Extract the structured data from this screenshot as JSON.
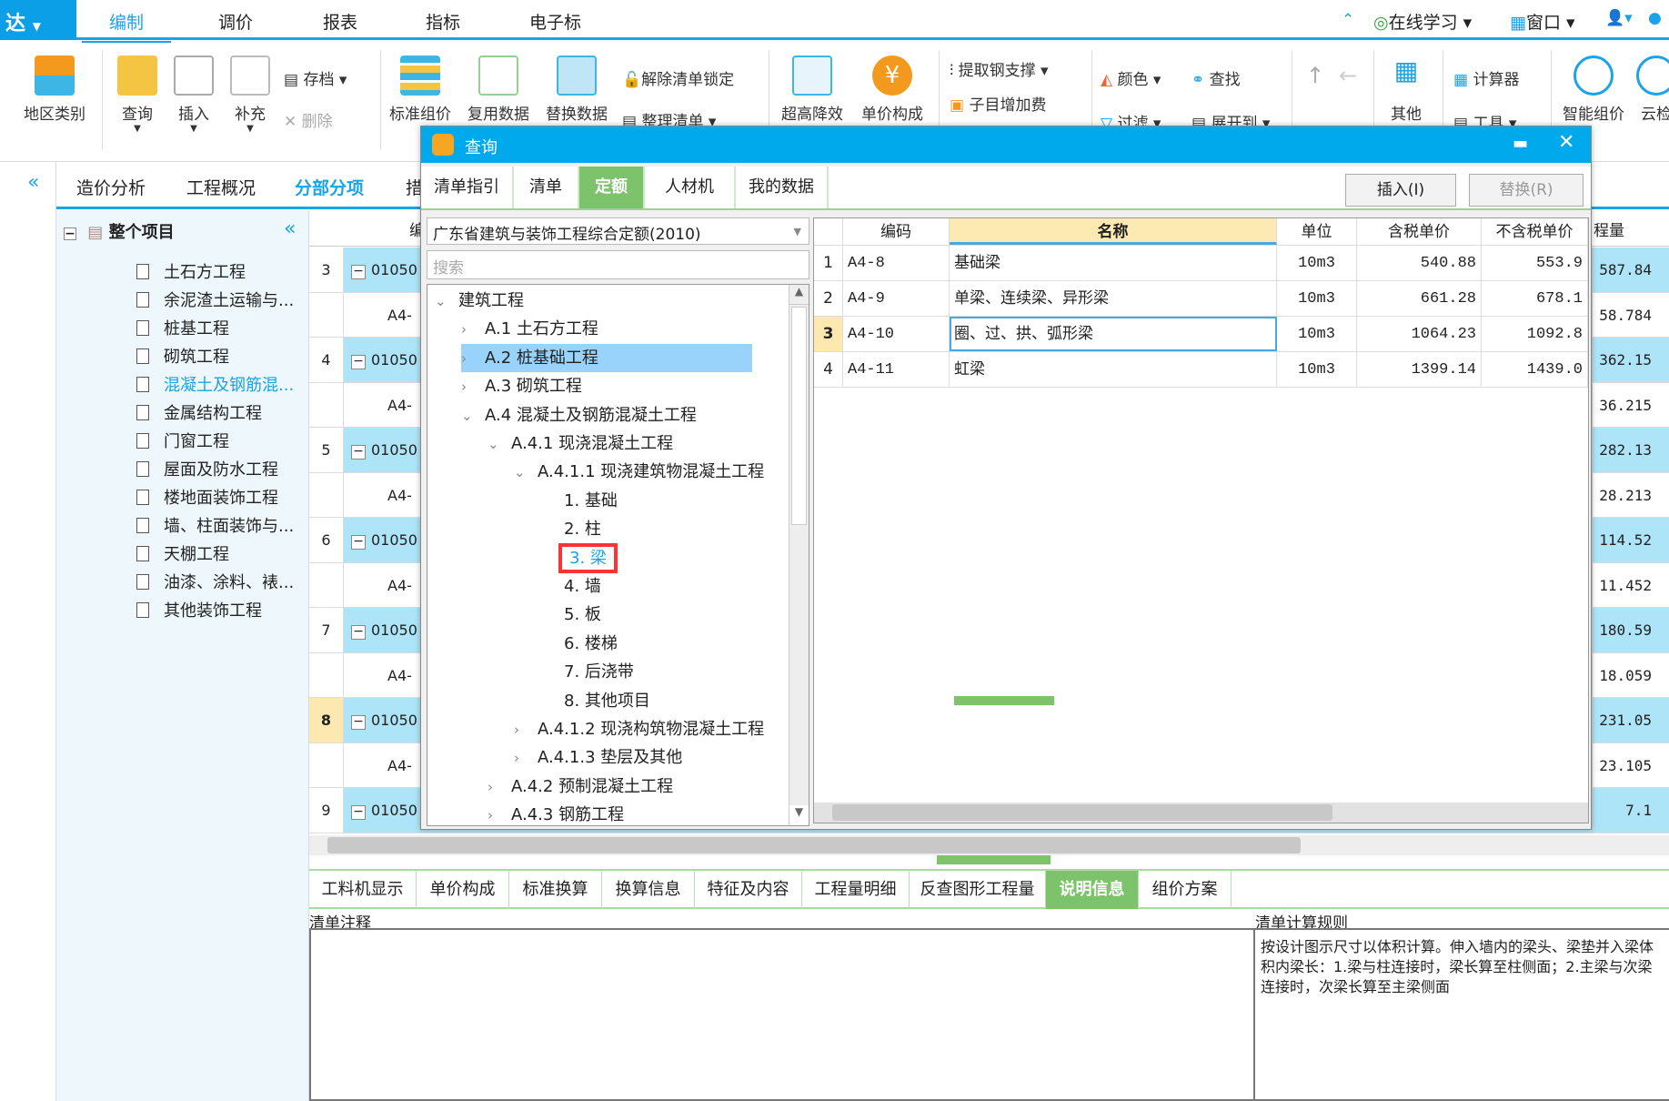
{
  "menubar": {
    "brand": "达",
    "tabs": [
      "编制",
      "调价",
      "报表",
      "指标",
      "电子标"
    ],
    "right": {
      "online": "在线学习",
      "window": "窗口"
    }
  },
  "ribbon": {
    "big": [
      "地区类别",
      "查询",
      "插入",
      "补充",
      "标准组价",
      "复用数据",
      "替换数据",
      "超高降效",
      "单价构成",
      "其他",
      "智能组价",
      "云检"
    ],
    "small": {
      "archive": "存档",
      "delete": "删除",
      "unlock": "解除清单锁定",
      "organize": "整理清单",
      "steel": "提取钢支撑",
      "fee": "子目增加费",
      "color": "颜色",
      "find": "查找",
      "filter": "过滤",
      "expand": "展开到",
      "calc": "计算器",
      "tools": "工具"
    }
  },
  "viewtabs": [
    "造价分析",
    "工程概况",
    "分部分项",
    "措"
  ],
  "projtree": {
    "root": "整个项目",
    "items": [
      "土石方工程",
      "余泥渣土运输与...",
      "桩基工程",
      "砌筑工程",
      "混凝土及钢筋混...",
      "金属结构工程",
      "门窗工程",
      "屋面及防水工程",
      "楼地面装饰工程",
      "墙、柱面装饰与...",
      "天棚工程",
      "油漆、涂料、裱...",
      "其他装饰工程"
    ],
    "selected_index": 4
  },
  "grid": {
    "header_code": "编",
    "header_qty": "程量",
    "rows": [
      {
        "num": "3",
        "code": "01050",
        "qty": "587.84",
        "parent": true
      },
      {
        "num": "",
        "code": "A4-",
        "qty": "58.784"
      },
      {
        "num": "4",
        "code": "01050",
        "qty": "362.15",
        "parent": true
      },
      {
        "num": "",
        "code": "A4-",
        "qty": "36.215"
      },
      {
        "num": "5",
        "code": "01050",
        "qty": "282.13",
        "parent": true
      },
      {
        "num": "",
        "code": "A4-",
        "qty": "28.213"
      },
      {
        "num": "6",
        "code": "01050",
        "qty": "114.52",
        "parent": true
      },
      {
        "num": "",
        "code": "A4-",
        "qty": "11.452"
      },
      {
        "num": "7",
        "code": "01050",
        "qty": "180.59",
        "parent": true
      },
      {
        "num": "",
        "code": "A4-",
        "qty": "18.059"
      },
      {
        "num": "8",
        "code": "01050",
        "qty": "231.05",
        "parent": true,
        "current": true
      },
      {
        "num": "",
        "code": "A4-",
        "qty": "23.105"
      },
      {
        "num": "9",
        "code": "01050",
        "qty": "7.1",
        "parent": true
      }
    ]
  },
  "bottomtabs": {
    "items": [
      "工料机显示",
      "单价构成",
      "标准换算",
      "换算信息",
      "特征及内容",
      "工程量明细",
      "反查图形工程量",
      "说明信息",
      "组价方案"
    ],
    "active_index": 7
  },
  "notes": {
    "left_label": "清单注释",
    "left_text": "",
    "right_label": "清单计算规则",
    "right_text": "按设计图示尺寸以体积计算。伸入墙内的梁头、梁垫并入梁体积内梁长：1.梁与柱连接时，梁长算至柱侧面；2.主梁与次梁连接时，次梁长算至主梁侧面"
  },
  "dialog": {
    "title": "查询",
    "tabs": [
      "清单指引",
      "清单",
      "定额",
      "人材机",
      "我的数据"
    ],
    "active_tab": 2,
    "insert": "插入(I)",
    "replace": "替换(R)",
    "library": "广东省建筑与装饰工程综合定额(2010)",
    "search_placeholder": "搜索",
    "tree": [
      {
        "label": "建筑工程",
        "level": 0,
        "chev": "v"
      },
      {
        "label": "A.1  土石方工程",
        "level": 1,
        "chev": ">"
      },
      {
        "label": "A.2  桩基础工程",
        "level": 1,
        "chev": ">",
        "highlight": true
      },
      {
        "label": "A.3  砌筑工程",
        "level": 1,
        "chev": ">"
      },
      {
        "label": "A.4  混凝土及钢筋混凝土工程",
        "level": 1,
        "chev": "v"
      },
      {
        "label": "A.4.1  现浇混凝土工程",
        "level": 2,
        "chev": "v"
      },
      {
        "label": "A.4.1.1  现浇建筑物混凝土工程",
        "level": 3,
        "chev": "v"
      },
      {
        "label": "1.  基础",
        "level": 4
      },
      {
        "label": "2.  柱",
        "level": 4
      },
      {
        "label": "3.  梁",
        "level": 4,
        "selected": true
      },
      {
        "label": "4.  墙",
        "level": 4
      },
      {
        "label": "5.  板",
        "level": 4
      },
      {
        "label": "6.  楼梯",
        "level": 4
      },
      {
        "label": "7.  后浇带",
        "level": 4
      },
      {
        "label": "8.  其他项目",
        "level": 4
      },
      {
        "label": "A.4.1.2  现浇构筑物混凝土工程",
        "level": 3,
        "chev": ">"
      },
      {
        "label": "A.4.1.3  垫层及其他",
        "level": 3,
        "chev": ">"
      },
      {
        "label": "A.4.2  预制混凝土工程",
        "level": 2,
        "chev": ">"
      },
      {
        "label": "A.4.3  钢筋工程",
        "level": 2,
        "chev": ">"
      }
    ],
    "table": {
      "headers": [
        "",
        "编码",
        "名称",
        "单位",
        "含税单价",
        "不含税单价"
      ],
      "rows": [
        [
          "1",
          "A4-8",
          "基础梁",
          "10m3",
          "540.88",
          "553.9"
        ],
        [
          "2",
          "A4-9",
          "单梁、连续梁、异形梁",
          "10m3",
          "661.28",
          "678.1"
        ],
        [
          "3",
          "A4-10",
          "圈、过、拱、弧形梁",
          "10m3",
          "1064.23",
          "1092.8"
        ],
        [
          "4",
          "A4-11",
          "虹梁",
          "10m3",
          "1399.14",
          "1439.0"
        ]
      ],
      "current_row": 2
    }
  },
  "colors": {
    "accent": "#00a9ec",
    "green": "#7cc36b",
    "row_blue": "#aee4f8",
    "current": "#fde9b0",
    "red_box": "#ff3333"
  }
}
